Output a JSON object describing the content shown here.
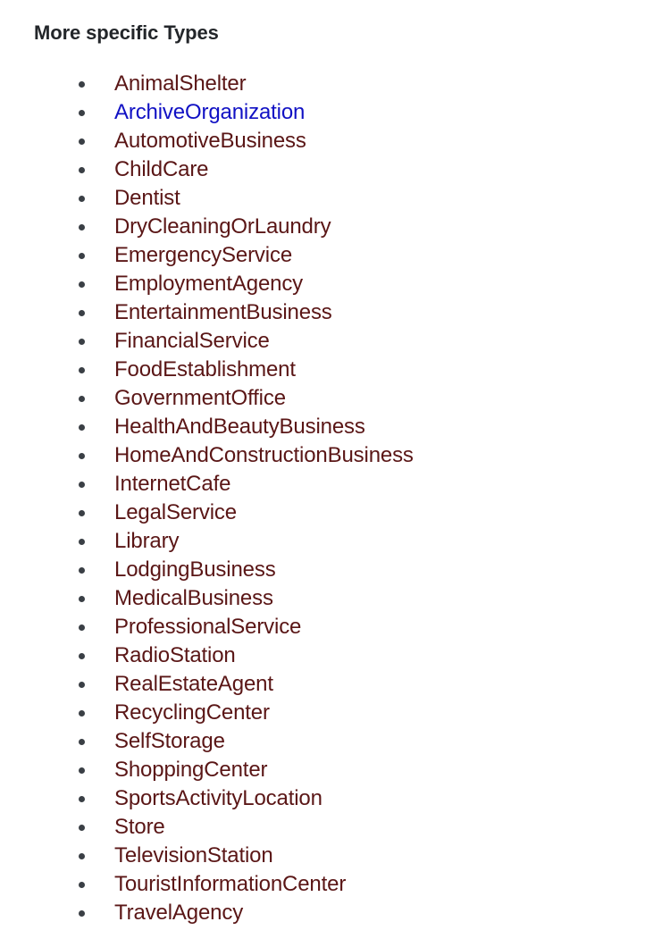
{
  "heading": "More specific Types",
  "colors": {
    "background": "#ffffff",
    "heading_text": "#23262a",
    "visited_link": "#5a1616",
    "unvisited_link": "#1111c4",
    "bullet": "#3a3f45"
  },
  "list": {
    "marker": "bullet-disc",
    "items": [
      {
        "label": "AnimalShelter",
        "state": "visited"
      },
      {
        "label": "ArchiveOrganization",
        "state": "unvisited"
      },
      {
        "label": "AutomotiveBusiness",
        "state": "visited"
      },
      {
        "label": "ChildCare",
        "state": "visited"
      },
      {
        "label": "Dentist",
        "state": "visited"
      },
      {
        "label": "DryCleaningOrLaundry",
        "state": "visited"
      },
      {
        "label": "EmergencyService",
        "state": "visited"
      },
      {
        "label": "EmploymentAgency",
        "state": "visited"
      },
      {
        "label": "EntertainmentBusiness",
        "state": "visited"
      },
      {
        "label": "FinancialService",
        "state": "visited"
      },
      {
        "label": "FoodEstablishment",
        "state": "visited"
      },
      {
        "label": "GovernmentOffice",
        "state": "visited"
      },
      {
        "label": "HealthAndBeautyBusiness",
        "state": "visited"
      },
      {
        "label": "HomeAndConstructionBusiness",
        "state": "visited"
      },
      {
        "label": "InternetCafe",
        "state": "visited"
      },
      {
        "label": "LegalService",
        "state": "visited"
      },
      {
        "label": "Library",
        "state": "visited"
      },
      {
        "label": "LodgingBusiness",
        "state": "visited"
      },
      {
        "label": "MedicalBusiness",
        "state": "visited"
      },
      {
        "label": "ProfessionalService",
        "state": "visited"
      },
      {
        "label": "RadioStation",
        "state": "visited"
      },
      {
        "label": "RealEstateAgent",
        "state": "visited"
      },
      {
        "label": "RecyclingCenter",
        "state": "visited"
      },
      {
        "label": "SelfStorage",
        "state": "visited"
      },
      {
        "label": "ShoppingCenter",
        "state": "visited"
      },
      {
        "label": "SportsActivityLocation",
        "state": "visited"
      },
      {
        "label": "Store",
        "state": "visited"
      },
      {
        "label": "TelevisionStation",
        "state": "visited"
      },
      {
        "label": "TouristInformationCenter",
        "state": "visited"
      },
      {
        "label": "TravelAgency",
        "state": "visited"
      }
    ]
  }
}
